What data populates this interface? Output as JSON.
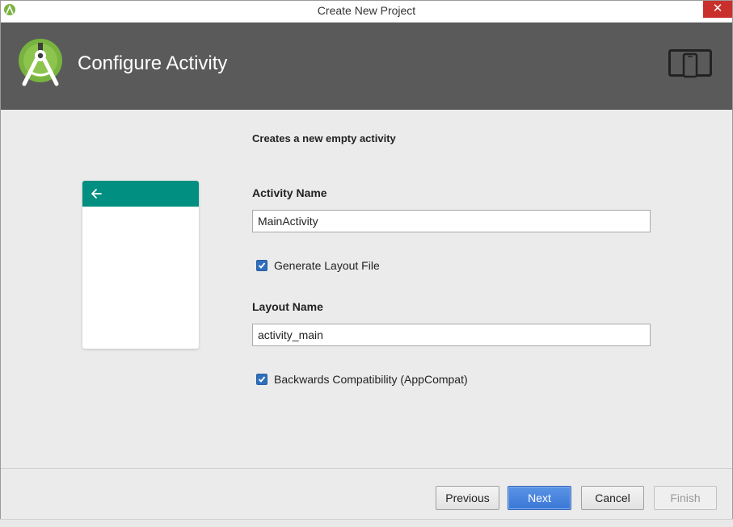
{
  "window": {
    "title": "Create New Project",
    "close_glyph": "✕",
    "app_icon": "android-studio-icon"
  },
  "header": {
    "title": "Configure Activity",
    "logo_icon": "android-studio-logo-icon",
    "device_icon": "phone-tablet-icon",
    "background": "#5a5a5a"
  },
  "form": {
    "description": "Creates a new empty activity",
    "activity_name_label": "Activity Name",
    "activity_name_value": "MainActivity",
    "generate_layout_label": "Generate Layout File",
    "generate_layout_checked": true,
    "layout_name_label": "Layout Name",
    "layout_name_value": "activity_main",
    "backwards_compat_label": "Backwards Compatibility (AppCompat)",
    "backwards_compat_checked": true
  },
  "preview": {
    "toolbar_color": "#008f80",
    "back_icon": "arrow-left-icon"
  },
  "buttons": {
    "previous": "Previous",
    "next": "Next",
    "cancel": "Cancel",
    "finish": "Finish"
  }
}
